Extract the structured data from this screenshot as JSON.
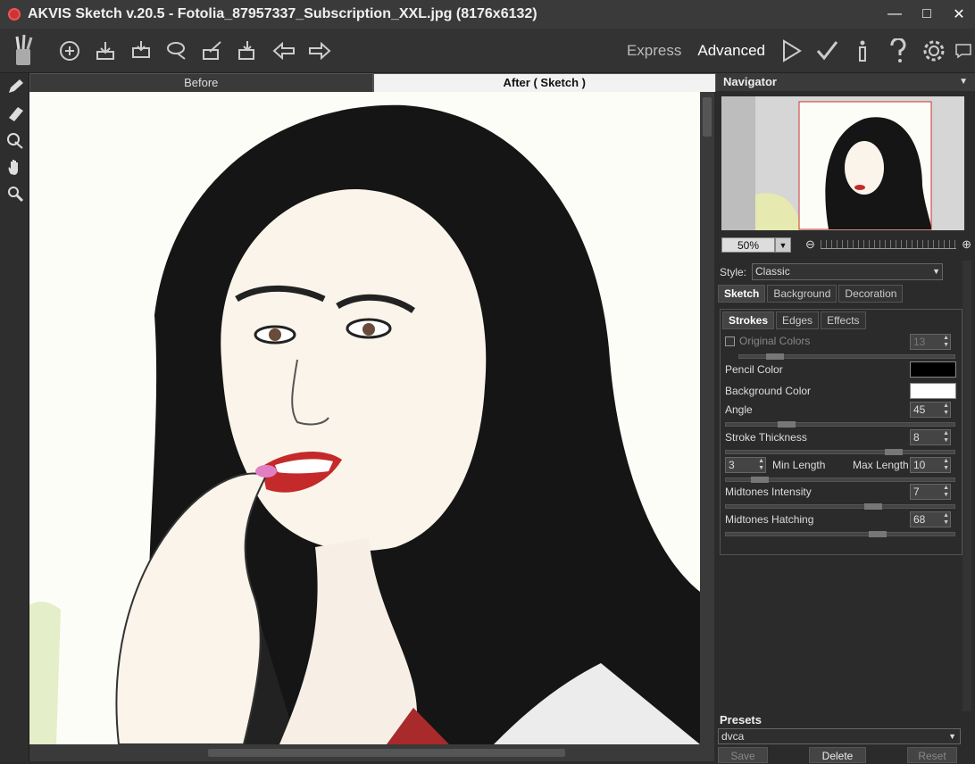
{
  "window": {
    "title": "AKVIS Sketch v.20.5 - Fotolia_87957337_Subscription_XXL.jpg (8176x6132)"
  },
  "toolbar": {
    "express_label": "Express",
    "advanced_label": "Advanced"
  },
  "view_tabs": {
    "before": "Before",
    "after": "After ( Sketch )"
  },
  "navigator": {
    "title": "Navigator",
    "zoom": "50%"
  },
  "style": {
    "label": "Style:",
    "value": "Classic"
  },
  "tabs": [
    "Sketch",
    "Background",
    "Decoration"
  ],
  "subtabs": [
    "Strokes",
    "Edges",
    "Effects"
  ],
  "params": {
    "original_colors": {
      "label": "Original Colors",
      "value": "13",
      "checked": false
    },
    "pencil_color": {
      "label": "Pencil Color",
      "color": "#000000"
    },
    "background_color": {
      "label": "Background Color",
      "color": "#ffffff"
    },
    "angle": {
      "label": "Angle",
      "value": "45"
    },
    "stroke_thickness": {
      "label": "Stroke Thickness",
      "value": "8"
    },
    "min_length": {
      "label": "Min Length",
      "value": "3"
    },
    "max_length": {
      "label": "Max Length",
      "value": "10"
    },
    "midtones_intensity": {
      "label": "Midtones Intensity",
      "value": "7"
    },
    "midtones_hatching": {
      "label": "Midtones Hatching",
      "value": "68"
    }
  },
  "presets": {
    "label": "Presets",
    "value": "dvca",
    "save": "Save",
    "delete": "Delete",
    "reset": "Reset"
  }
}
